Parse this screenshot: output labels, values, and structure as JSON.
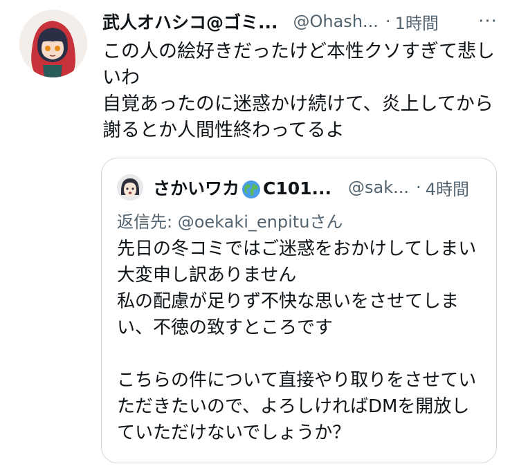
{
  "tweet": {
    "display_name": "武人オハシコ@ゴミ...",
    "handle": "@Ohash...",
    "separator": "·",
    "time": "1時間",
    "more_label": "···",
    "body_lines": [
      "この人の絵好きだったけど本性クソすぎて悲し",
      "いわ",
      "自覚あったのに迷惑かけ続けて、炎上してから",
      "謝るとか人間性終わってるよ"
    ]
  },
  "quoted": {
    "display_name": "さかいワカ",
    "name_suffix": "C101...",
    "handle": "@sak...",
    "separator": "·",
    "time": "4時間",
    "reply_prefix": "返信先: ",
    "reply_mention": "@oekaki_enpitu",
    "reply_suffix": "さん",
    "body_lines": [
      "先日の冬コミではご迷惑をおかけしてしまい",
      "大変申し訳ありません",
      "私の配慮が足りず不快な思いをさせてしま",
      "い、不徳の致すところです",
      "",
      "こちらの件について直接やり取りをさせてい",
      "ただきたいので、よろしければDMを開放し",
      "ていただけないでしょうか？"
    ]
  },
  "icons": {
    "avatar": "red-hood-character-avatar",
    "quoted_avatar": "character-avatar",
    "globe": "globe-emoji-icon",
    "more": "more-icon"
  },
  "colors": {
    "text": "#0f1419",
    "secondary": "#536471",
    "border": "#cfd9de"
  }
}
